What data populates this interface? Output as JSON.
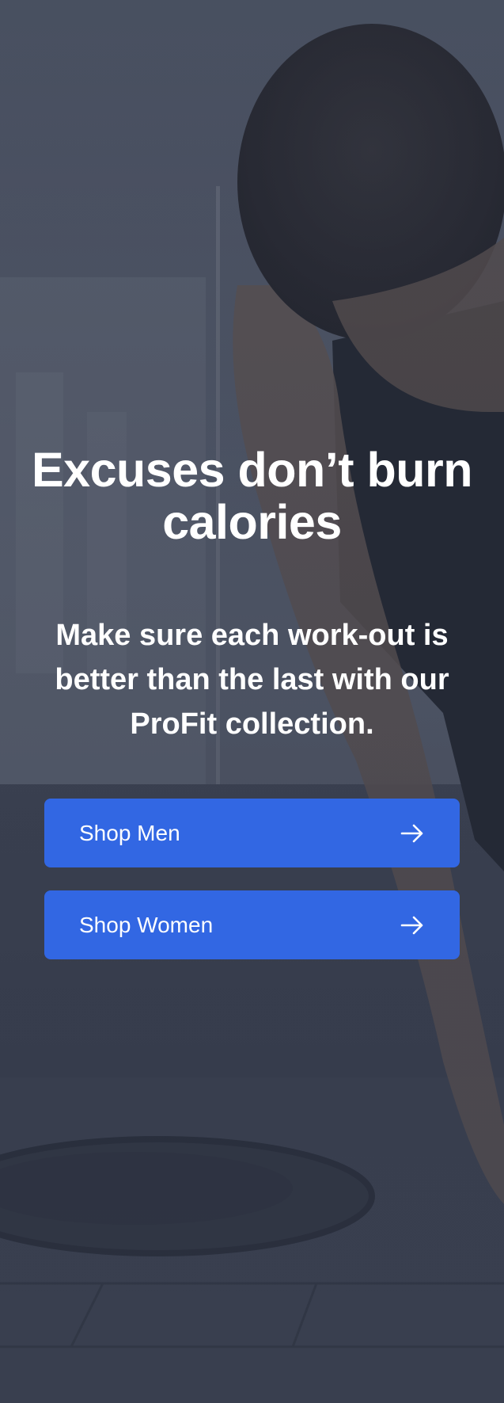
{
  "hero": {
    "headline": "Excuses don’t burn calories",
    "subtext": "Make sure each work-out is better than the last with our ProFit collection.",
    "background_image": "man-tying-shoe-photo"
  },
  "buttons": {
    "men": {
      "label": "Shop Men",
      "icon": "arrow-right-icon"
    },
    "women": {
      "label": "Shop Women",
      "icon": "arrow-right-icon"
    }
  },
  "colors": {
    "button": "#3267e3",
    "overlay": "#222838",
    "text": "#ffffff"
  }
}
